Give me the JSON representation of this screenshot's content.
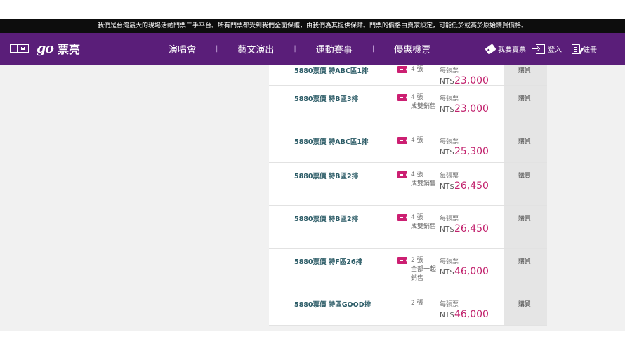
{
  "notice": "我們是台灣最大的現場活動門票二手平台。所有門票都受到我們全面保護，由我們為其提供保障。門票的價格由賣家設定，可能低於或高於原始購買價格。",
  "brand": {
    "logo_go": "go",
    "logo_text": "票亮"
  },
  "nav": {
    "items": [
      "演唱會",
      "藝文演出",
      "運動賽事",
      "優惠機票"
    ],
    "separator": "|"
  },
  "actions": {
    "sell": "我要賣票",
    "login": "登入",
    "register": "註冊"
  },
  "listings": [
    {
      "name": "5880票價 特ABC區1排",
      "qty": "4 張",
      "note": "",
      "per_label": "每張票",
      "currency": "NT$",
      "price": "23,000",
      "buy": "購買",
      "ticket_icon": true
    },
    {
      "name": "5880票價 特B區3排",
      "qty": "4 張",
      "note": "成雙銷售",
      "per_label": "每張票",
      "currency": "NT$",
      "price": "23,000",
      "buy": "購買",
      "ticket_icon": true
    },
    {
      "name": "5880票價 特ABC區1排",
      "qty": "4 張",
      "note": "",
      "per_label": "每張票",
      "currency": "NT$",
      "price": "25,300",
      "buy": "購買",
      "ticket_icon": true
    },
    {
      "name": "5880票價 特B區2排",
      "qty": "4 張",
      "note": "成雙銷售",
      "per_label": "每張票",
      "currency": "NT$",
      "price": "26,450",
      "buy": "購買",
      "ticket_icon": true
    },
    {
      "name": "5880票價 特B區2排",
      "qty": "4 張",
      "note": "成雙銷售",
      "per_label": "每張票",
      "currency": "NT$",
      "price": "26,450",
      "buy": "購買",
      "ticket_icon": true
    },
    {
      "name": "5880票價 特F區26排",
      "qty": "2 張",
      "note": "全部一起銷售",
      "per_label": "每張票",
      "currency": "NT$",
      "price": "46,000",
      "buy": "購買",
      "ticket_icon": true
    },
    {
      "name": "5880票價 特區GOOD排",
      "qty": "2 張",
      "note": "",
      "per_label": "每張票",
      "currency": "NT$",
      "price": "46,000",
      "buy": "購買",
      "ticket_icon": false
    }
  ],
  "colors": {
    "nav_bg": "#5a1e79",
    "accent": "#c11f6b",
    "name_text": "#2b5b66",
    "notice_bg": "#0d0d0d"
  }
}
